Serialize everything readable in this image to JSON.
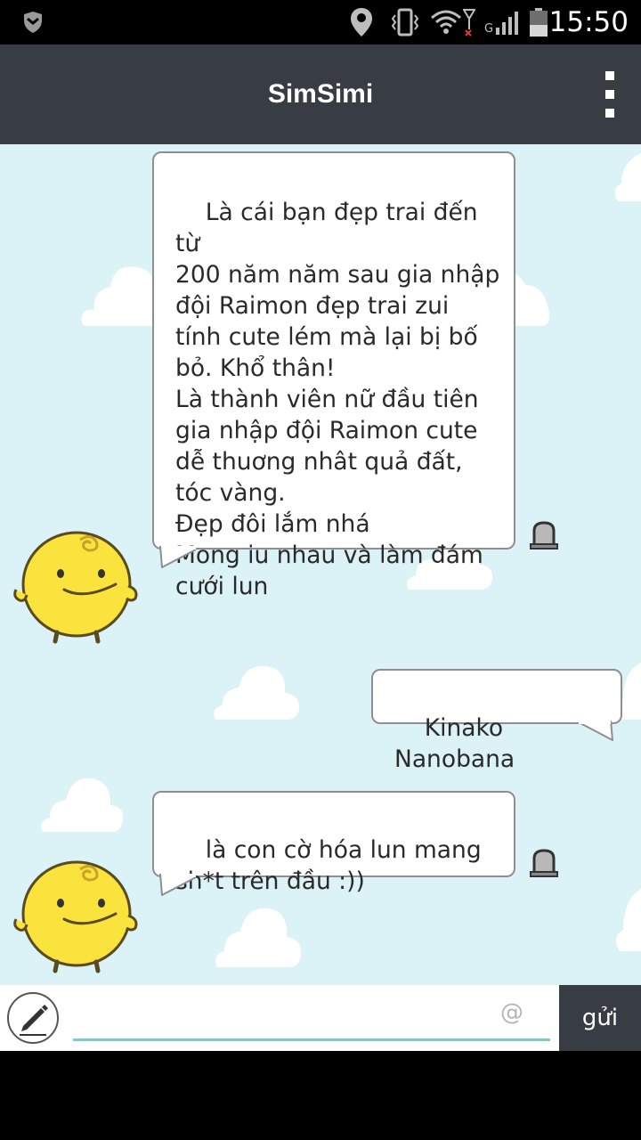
{
  "status_bar": {
    "time": "15:50",
    "icons": [
      "notification-shield-icon",
      "location-icon",
      "vibrate-icon",
      "wifi-icon",
      "signal-icon",
      "battery-icon"
    ],
    "signal_label": "G"
  },
  "app_bar": {
    "title": "SimSimi",
    "menu_icon": "overflow-menu-icon"
  },
  "messages": [
    {
      "sender": "simsimi",
      "text": "Là cái bạn đẹp trai đến từ\n200 năm năm sau gia nhập\nđội Raimon đẹp trai zui\ntính cute lém mà lại bị bố\nbỏ. Khổ thân!\nLà thành viên nữ đầu tiên\ngia nhập đội Raimon cute\ndễ thuơng nhât quả đất,\ntóc vàng.\nĐẹp đôi lắm nhá\nMong iu nhau và làm đám\ncưới lun"
    },
    {
      "sender": "user",
      "text": "Kinako Nanobana"
    },
    {
      "sender": "simsimi",
      "text": "là con cờ hóa lun mang\nsh*t trên đầu :))"
    }
  ],
  "input_bar": {
    "placeholder": "",
    "value": "",
    "at_symbol": "@",
    "send_label": "gửi",
    "edit_icon": "pencil-icon"
  },
  "colors": {
    "app_bar": "#383c43",
    "chat_background": "#dbf2f6",
    "input_underline": "#7ccbc6",
    "avatar_yellow": "#f9e33c"
  }
}
